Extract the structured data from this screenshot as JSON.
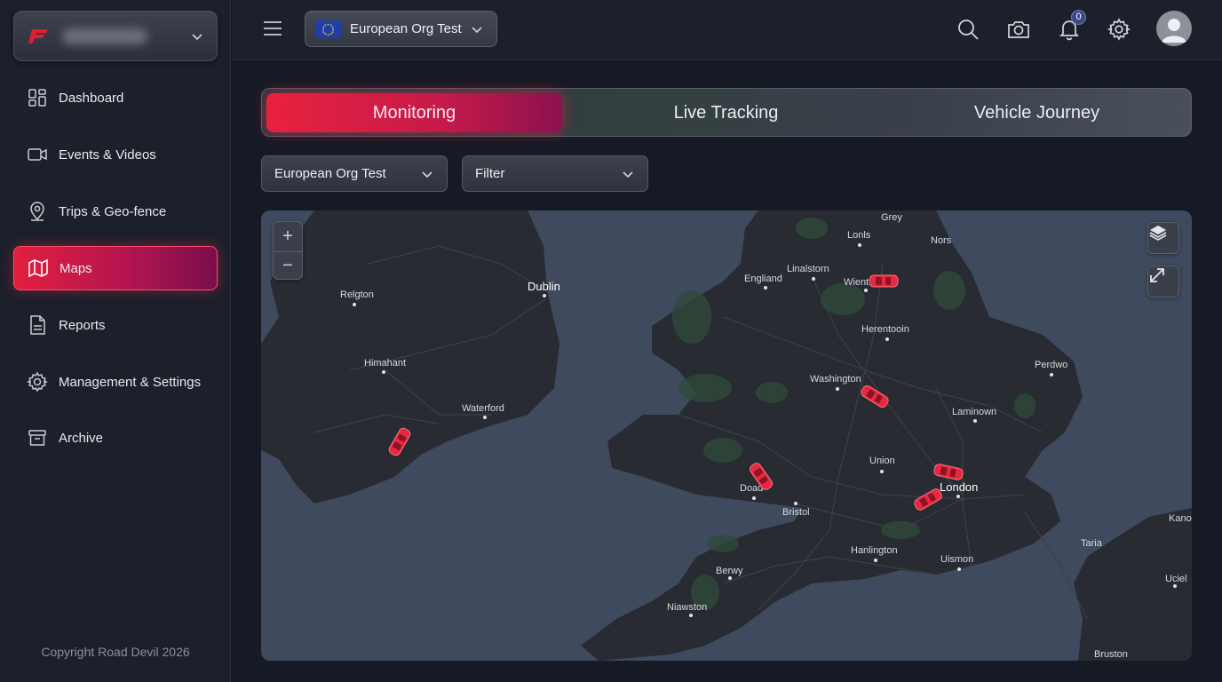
{
  "brand": {
    "logo": "road-devil-logo",
    "name": "Road Devil"
  },
  "sidebar": {
    "items": [
      {
        "label": "Dashboard",
        "icon": "dashboard-icon"
      },
      {
        "label": "Events & Videos",
        "icon": "video-camera-icon"
      },
      {
        "label": "Trips & Geo-fence",
        "icon": "map-pin-icon"
      },
      {
        "label": "Maps",
        "icon": "map-icon",
        "active": true
      },
      {
        "label": "Reports",
        "icon": "document-icon"
      },
      {
        "label": "Management & Settings",
        "icon": "gear-icon"
      },
      {
        "label": "Archive",
        "icon": "archive-box-icon"
      }
    ],
    "copyright": "Copyright Road Devil 2026"
  },
  "topbar": {
    "org_select": "European Org Test",
    "flag": "eu-flag-icon",
    "notifications_count": "0"
  },
  "tabs": [
    {
      "label": "Monitoring",
      "active": true
    },
    {
      "label": "Live Tracking"
    },
    {
      "label": "Vehicle Journey"
    }
  ],
  "filters": {
    "org": "European Org Test",
    "filter": "Filter"
  },
  "map": {
    "zoom_in": "+",
    "zoom_out": "−",
    "cities": [
      "Grey",
      "Lonls",
      "Nors",
      "Linalstorn",
      "Engliand",
      "Wient",
      "Dublin",
      "Relgton",
      "Herentooin",
      "Himahant",
      "Perdwo",
      "Washington",
      "Waterford",
      "Laminown",
      "Union",
      "London",
      "Doad",
      "Bristol",
      "Kano",
      "Hanlington",
      "Uismon",
      "Taria",
      "Berwy",
      "Uciel",
      "Niawston",
      "Bruston"
    ],
    "vehicles": 6
  },
  "colors": {
    "accent": "#e01f3d",
    "accent_dark": "#7a0d4a",
    "sidebar_bg": "#1c202b",
    "page_bg": "#161a24",
    "map_water": "#3f4a5e",
    "map_land": "#272b33",
    "car": "#e8283f"
  }
}
